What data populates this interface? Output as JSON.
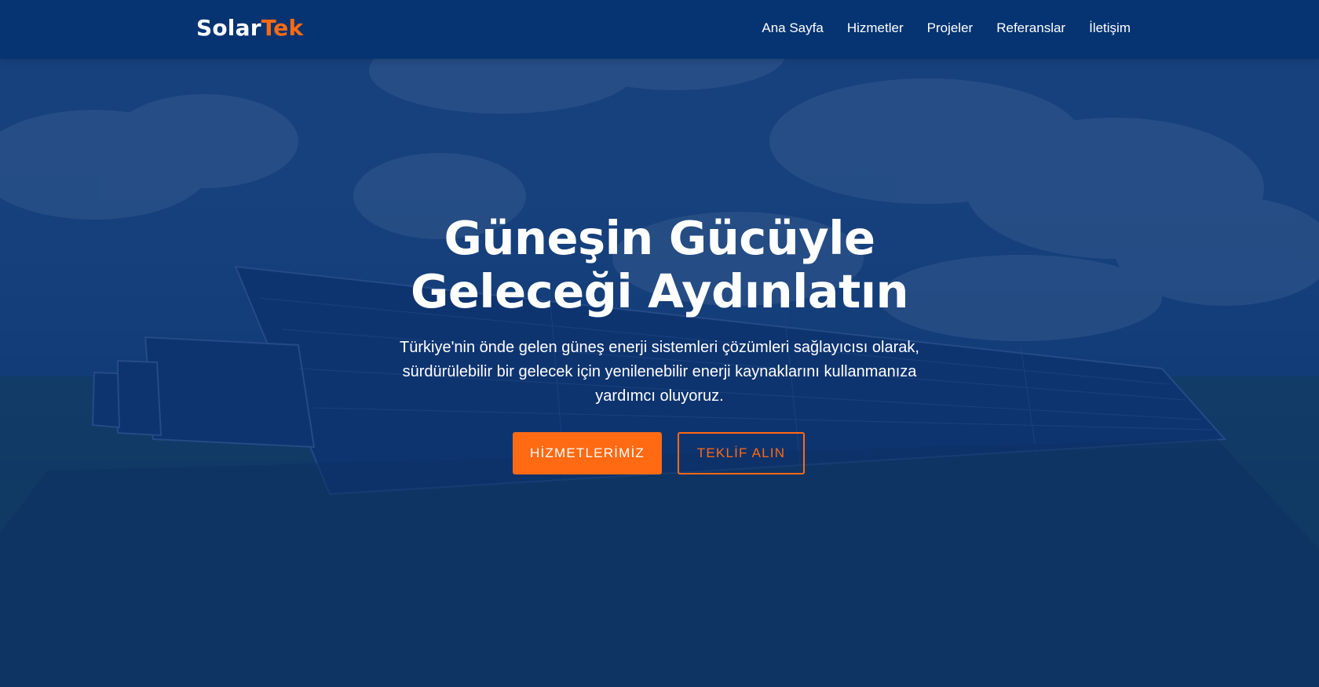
{
  "brand": {
    "part1": "Solar",
    "part2": "Tek",
    "accent": "#ff6a13"
  },
  "nav": {
    "items": [
      {
        "label": "Ana Sayfa"
      },
      {
        "label": "Hizmetler"
      },
      {
        "label": "Projeler"
      },
      {
        "label": "Referanslar"
      },
      {
        "label": "İletişim"
      }
    ]
  },
  "hero": {
    "title": "Güneşin Gücüyle Geleceği Aydınlatın",
    "subtitle": "Türkiye'nin önde gelen güneş enerji sistemleri çözümleri sağlayıcısı olarak, sürdürülebilir bir gelecek için yenilenebilir enerji kaynaklarını kullanmanıza yardımcı oluyoruz.",
    "primary_button": "HİZMETLERİMİZ",
    "secondary_button": "TEKLİF ALIN",
    "background_image": "solar-panel-field"
  },
  "colors": {
    "navbar": "#063472",
    "overlay": "#08306e",
    "accent": "#ff6a13"
  }
}
